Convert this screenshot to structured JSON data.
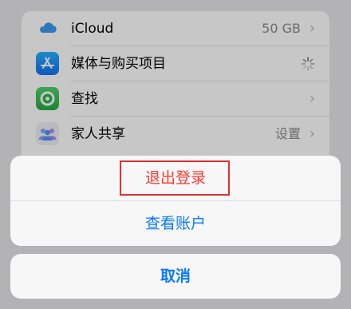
{
  "settings": {
    "items": [
      {
        "label": "iCloud",
        "value": "50 GB",
        "icon": "icloud-icon"
      },
      {
        "label": "媒体与购买项目",
        "value": "",
        "icon": "app-store-icon"
      },
      {
        "label": "查找",
        "value": "",
        "icon": "find-my-icon"
      },
      {
        "label": "家人共享",
        "value": "设置",
        "icon": "family-sharing-icon"
      }
    ]
  },
  "action_sheet": {
    "sign_out_label": "退出登录",
    "view_account_label": "查看账户",
    "cancel_label": "取消"
  },
  "colors": {
    "destructive": "#ff3b30",
    "tint": "#0a7aff",
    "highlight": "#e03131"
  }
}
